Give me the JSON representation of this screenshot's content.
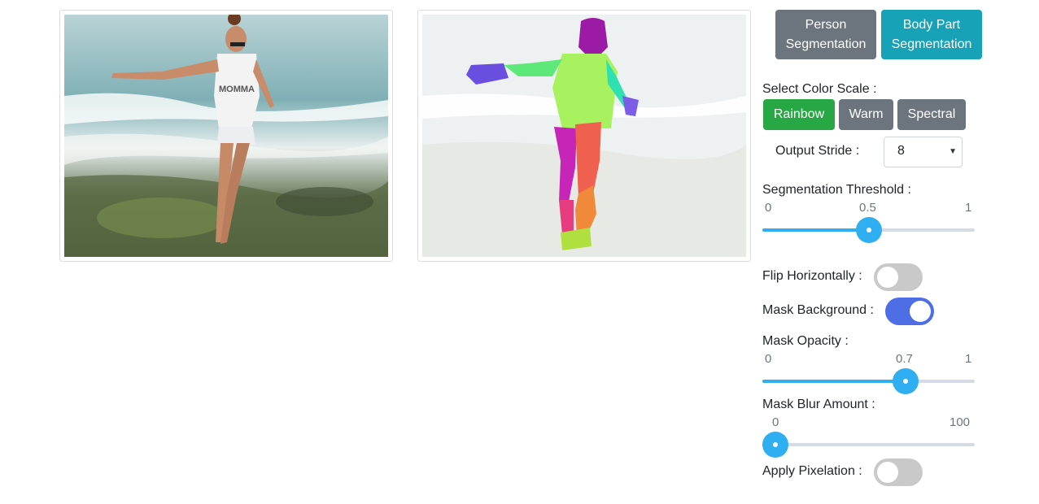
{
  "segmentation_buttons": {
    "person_line1": "Person",
    "person_line2": "Segmentation",
    "bodypart_line1": "Body Part",
    "bodypart_line2": "Segmentation"
  },
  "color_scale": {
    "label": "Select Color Scale :",
    "options": [
      "Rainbow",
      "Warm",
      "Spectral"
    ],
    "selected": "Rainbow"
  },
  "output_stride": {
    "label": "Output Stride :",
    "value": "8"
  },
  "segmentation_threshold": {
    "label": "Segmentation Threshold :",
    "min": "0",
    "value": "0.5",
    "max": "1",
    "fraction": 0.5
  },
  "flip_horizontally": {
    "label": "Flip Horizontally :",
    "on": false
  },
  "mask_background": {
    "label": "Mask Background :",
    "on": true
  },
  "mask_opacity": {
    "label": "Mask Opacity :",
    "min": "0",
    "value": "0.7",
    "max": "1",
    "fraction": 0.7
  },
  "mask_blur": {
    "label": "Mask Blur Amount :",
    "min": "0",
    "max": "100",
    "fraction": 0.0
  },
  "apply_pixelation": {
    "label": "Apply Pixelation :",
    "on": false
  },
  "colors": {
    "primary": "#2faef2",
    "toggle_on": "#4e6ee6",
    "teal": "#17a2b8",
    "green": "#28a745",
    "grey": "#6c757d"
  }
}
